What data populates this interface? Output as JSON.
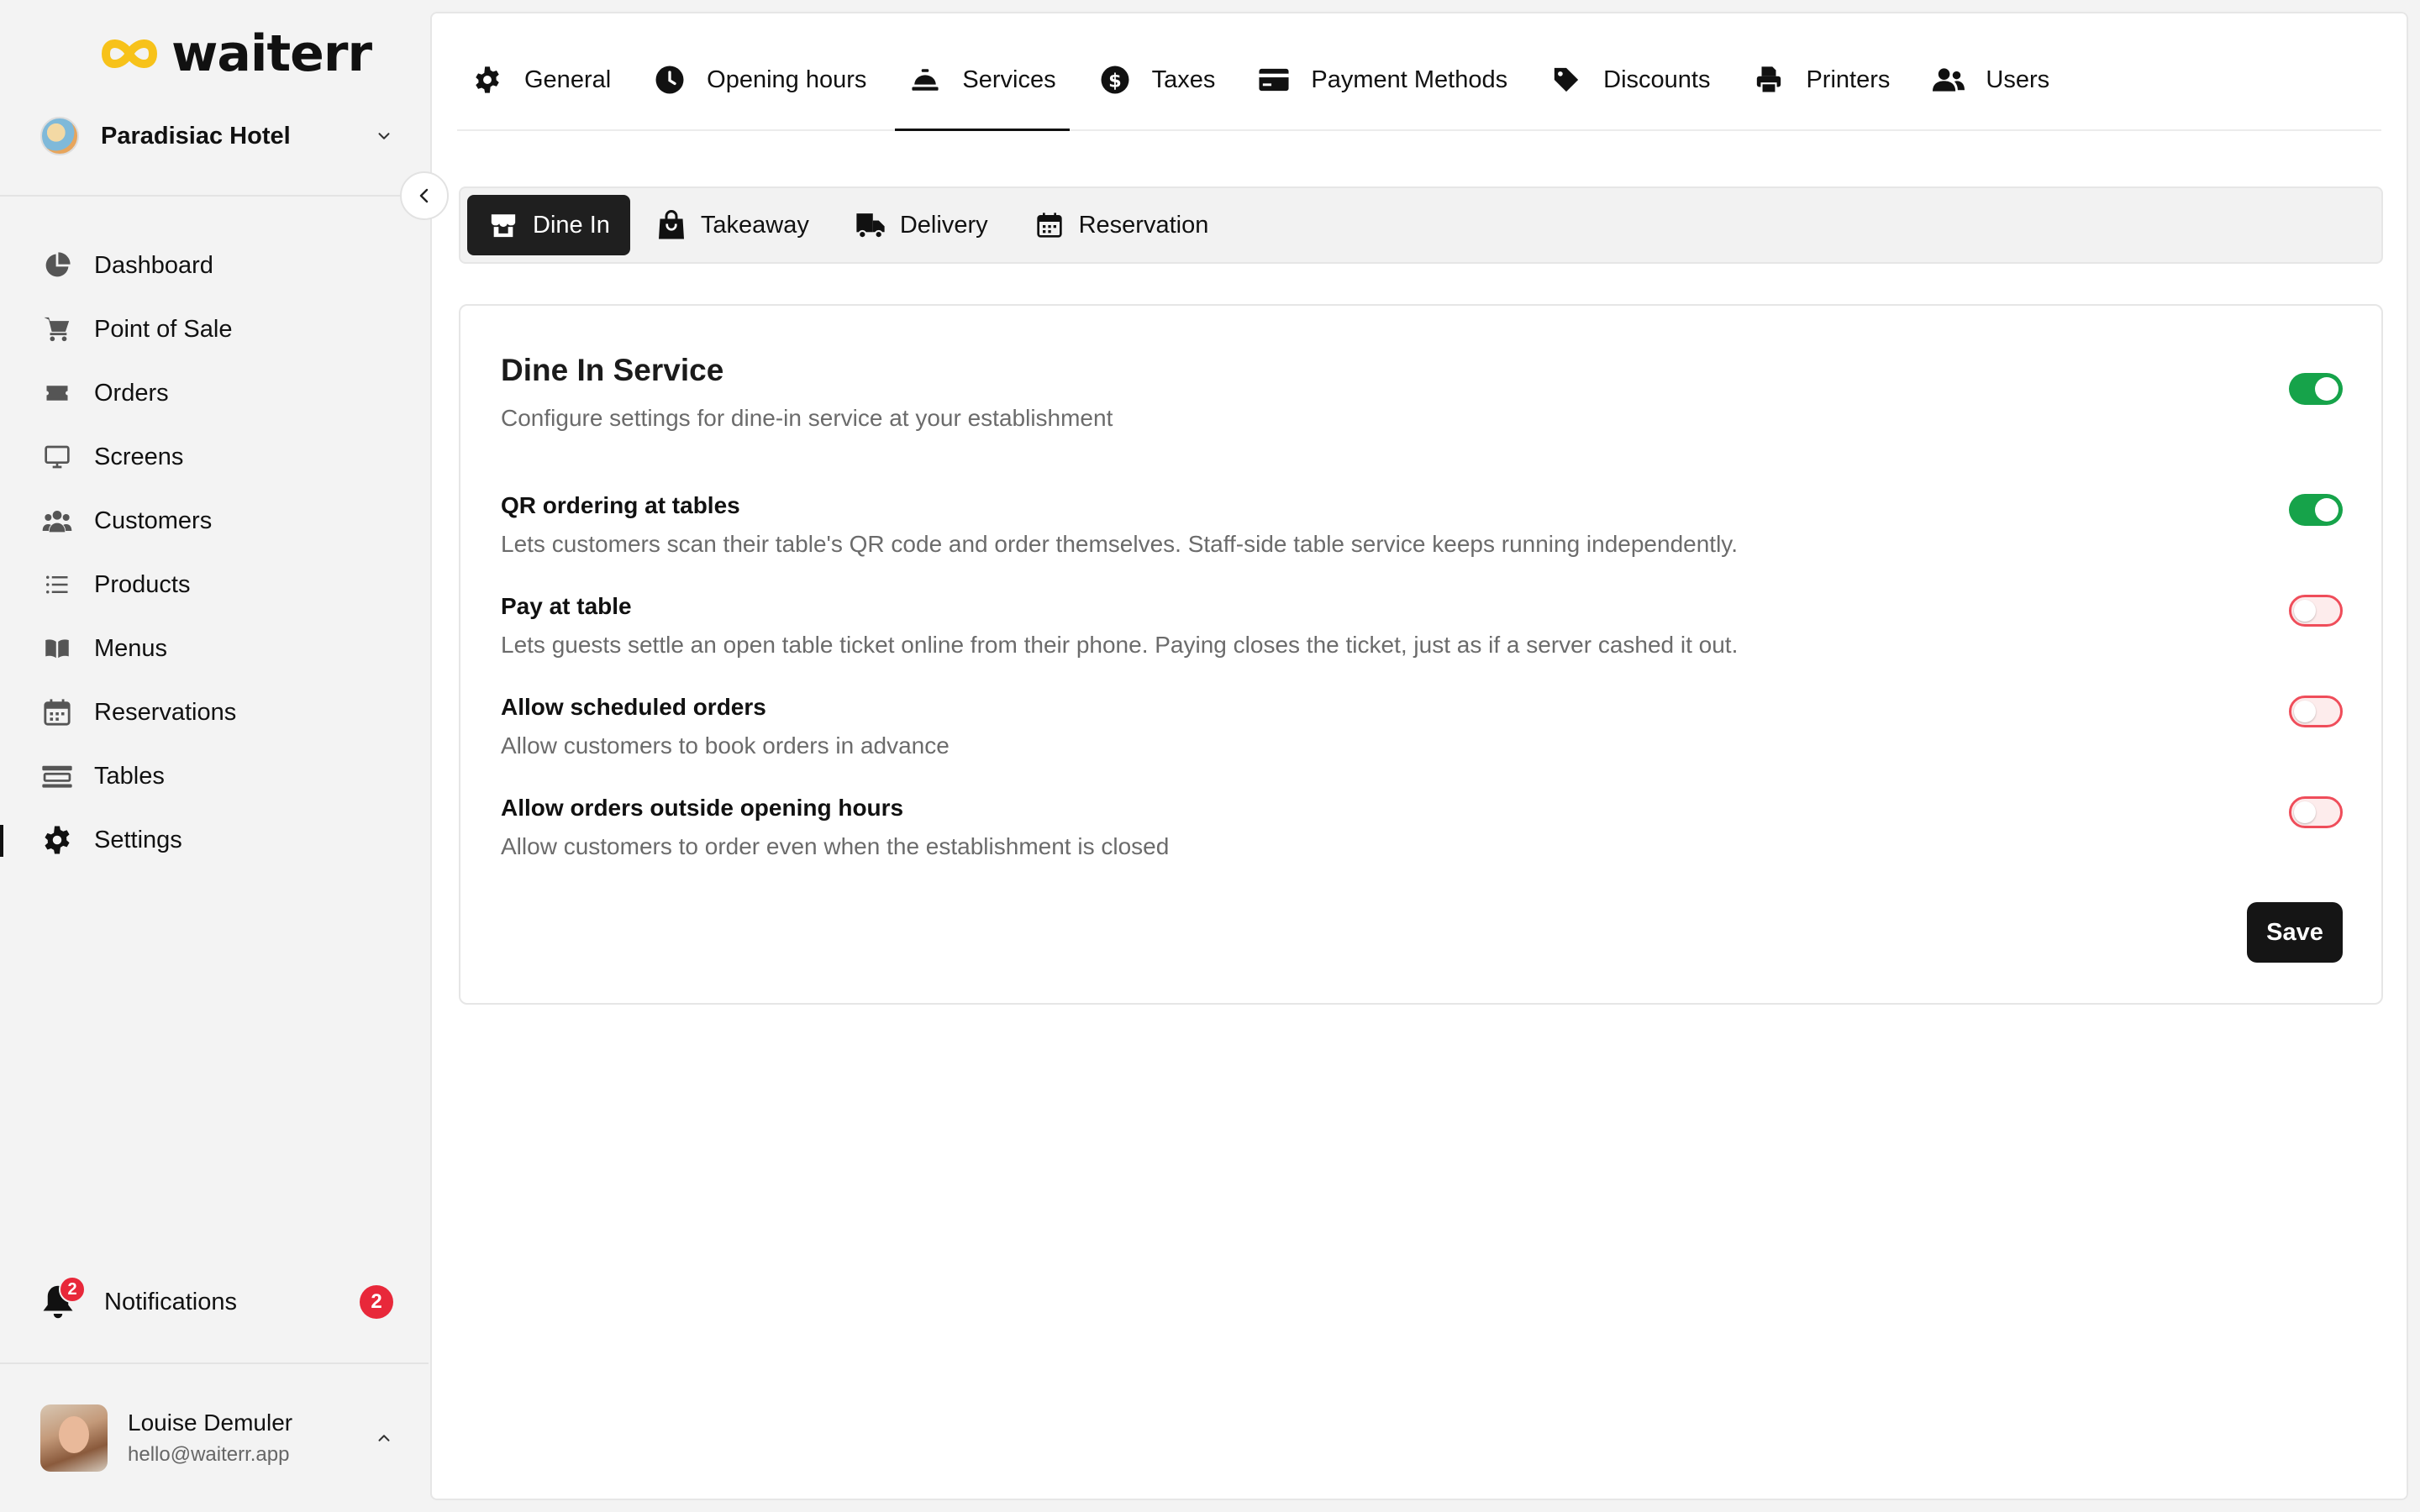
{
  "app": {
    "brand": "waiterr",
    "brand_color": "#f7c21a"
  },
  "sidebar": {
    "establishment": "Paradisiac Hotel",
    "items": [
      {
        "label": "Dashboard",
        "icon": "pie-chart-icon"
      },
      {
        "label": "Point of Sale",
        "icon": "cart-icon"
      },
      {
        "label": "Orders",
        "icon": "ticket-icon"
      },
      {
        "label": "Screens",
        "icon": "monitor-icon"
      },
      {
        "label": "Customers",
        "icon": "users-icon"
      },
      {
        "label": "Products",
        "icon": "list-icon"
      },
      {
        "label": "Menus",
        "icon": "book-icon"
      },
      {
        "label": "Reservations",
        "icon": "calendar-icon"
      },
      {
        "label": "Tables",
        "icon": "table-icon"
      },
      {
        "label": "Settings",
        "icon": "gear-icon",
        "active": true
      }
    ],
    "notifications": {
      "label": "Notifications",
      "count": "2"
    },
    "user": {
      "name": "Louise Demuler",
      "email": "hello@waiterr.app"
    }
  },
  "settings_tabs": [
    {
      "label": "General",
      "icon": "gear-icon"
    },
    {
      "label": "Opening hours",
      "icon": "clock-icon"
    },
    {
      "label": "Services",
      "icon": "service-bell-icon",
      "active": true
    },
    {
      "label": "Taxes",
      "icon": "dollar-icon"
    },
    {
      "label": "Payment Methods",
      "icon": "credit-card-icon"
    },
    {
      "label": "Discounts",
      "icon": "tag-icon"
    },
    {
      "label": "Printers",
      "icon": "printer-icon"
    },
    {
      "label": "Users",
      "icon": "user-group-icon"
    }
  ],
  "service_tabs": [
    {
      "label": "Dine In",
      "icon": "storefront-icon",
      "active": true
    },
    {
      "label": "Takeaway",
      "icon": "shopping-bag-icon"
    },
    {
      "label": "Delivery",
      "icon": "truck-icon"
    },
    {
      "label": "Reservation",
      "icon": "calendar-icon"
    }
  ],
  "card": {
    "title": "Dine In Service",
    "subtitle": "Configure settings for dine-in service at your establishment",
    "service_enabled": true,
    "settings": [
      {
        "title": "QR ordering at tables",
        "description": "Lets customers scan their table's QR code and order themselves. Staff-side table service keeps running independently.",
        "enabled": true
      },
      {
        "title": "Pay at table",
        "description": "Lets guests settle an open table ticket online from their phone. Paying closes the ticket, just as if a server cashed it out.",
        "enabled": false
      },
      {
        "title": "Allow scheduled orders",
        "description": "Allow customers to book orders in advance",
        "enabled": false
      },
      {
        "title": "Allow orders outside opening hours",
        "description": "Allow customers to order even when the establishment is closed",
        "enabled": false
      }
    ],
    "save_label": "Save"
  },
  "colors": {
    "toggle_on": "#16a34a",
    "toggle_off_border": "#ef4d5a",
    "badge": "#e8283a"
  }
}
